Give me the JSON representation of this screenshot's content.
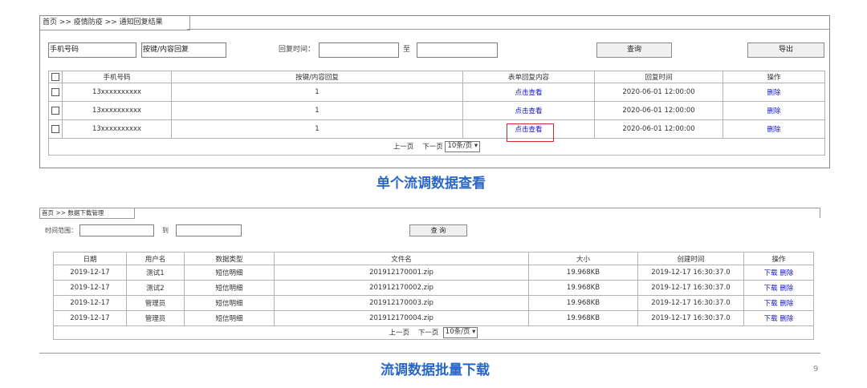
{
  "top": {
    "breadcrumb": "首页 >> 疫情防疫 >> 通知回复结果",
    "phone_input": "手机号码",
    "reply_input": "按键/内容回复",
    "time_label": "回复时间：",
    "to_label": "至",
    "query_button": "查询",
    "export_button": "导出",
    "headers": [
      "手机号码",
      "按键/内容回复",
      "表单回复内容",
      "回复时间",
      "操作"
    ],
    "rows": [
      {
        "phone": "13xxxxxxxxxx",
        "reply": "1",
        "view": "点击查看",
        "time": "2020-06-01 12:00:00",
        "action": "删除"
      },
      {
        "phone": "13xxxxxxxxxx",
        "reply": "1",
        "view": "点击查看",
        "time": "2020-06-01 12:00:00",
        "action": "删除"
      },
      {
        "phone": "13xxxxxxxxxx",
        "reply": "1",
        "view": "点击查看",
        "time": "2020-06-01 12:00:00",
        "action": "删除"
      }
    ],
    "pager": {
      "prev": "上一页",
      "next": "下一页",
      "page_size": "10条/页"
    },
    "caption": "单个流调数据查看"
  },
  "bottom": {
    "breadcrumb": "首页 >> 数据下载管理",
    "range_label": "时间范围：",
    "to_label": "到",
    "query_button": "查 询",
    "headers": [
      "日期",
      "用户名",
      "数据类型",
      "文件名",
      "大小",
      "创建时间",
      "操作"
    ],
    "rows": [
      {
        "date": "2019-12-17",
        "user": "测试1",
        "type": "短信明细",
        "file": "201912170001.zip",
        "size": "19.968KB",
        "created": "2019-12-17 16:30:37.0",
        "download": "下载",
        "delete": "删除"
      },
      {
        "date": "2019-12-17",
        "user": "测试2",
        "type": "短信明细",
        "file": "201912170002.zip",
        "size": "19.968KB",
        "created": "2019-12-17 16:30:37.0",
        "download": "下载",
        "delete": "删除"
      },
      {
        "date": "2019-12-17",
        "user": "管理员",
        "type": "短信明细",
        "file": "201912170003.zip",
        "size": "19.968KB",
        "created": "2019-12-17 16:30:37.0",
        "download": "下载",
        "delete": "删除"
      },
      {
        "date": "2019-12-17",
        "user": "管理员",
        "type": "短信明细",
        "file": "201912170004.zip",
        "size": "19.968KB",
        "created": "2019-12-17 16:30:37.0",
        "download": "下载",
        "delete": "删除"
      }
    ],
    "pager": {
      "prev": "上一页",
      "next": "下一页",
      "page_size": "10条/页"
    },
    "caption": "流调数据批量下载"
  },
  "page_number": "9",
  "colors": {
    "caption": "#2a67c7",
    "link": "#1515c8",
    "highlight_box": "#d12b2b"
  }
}
